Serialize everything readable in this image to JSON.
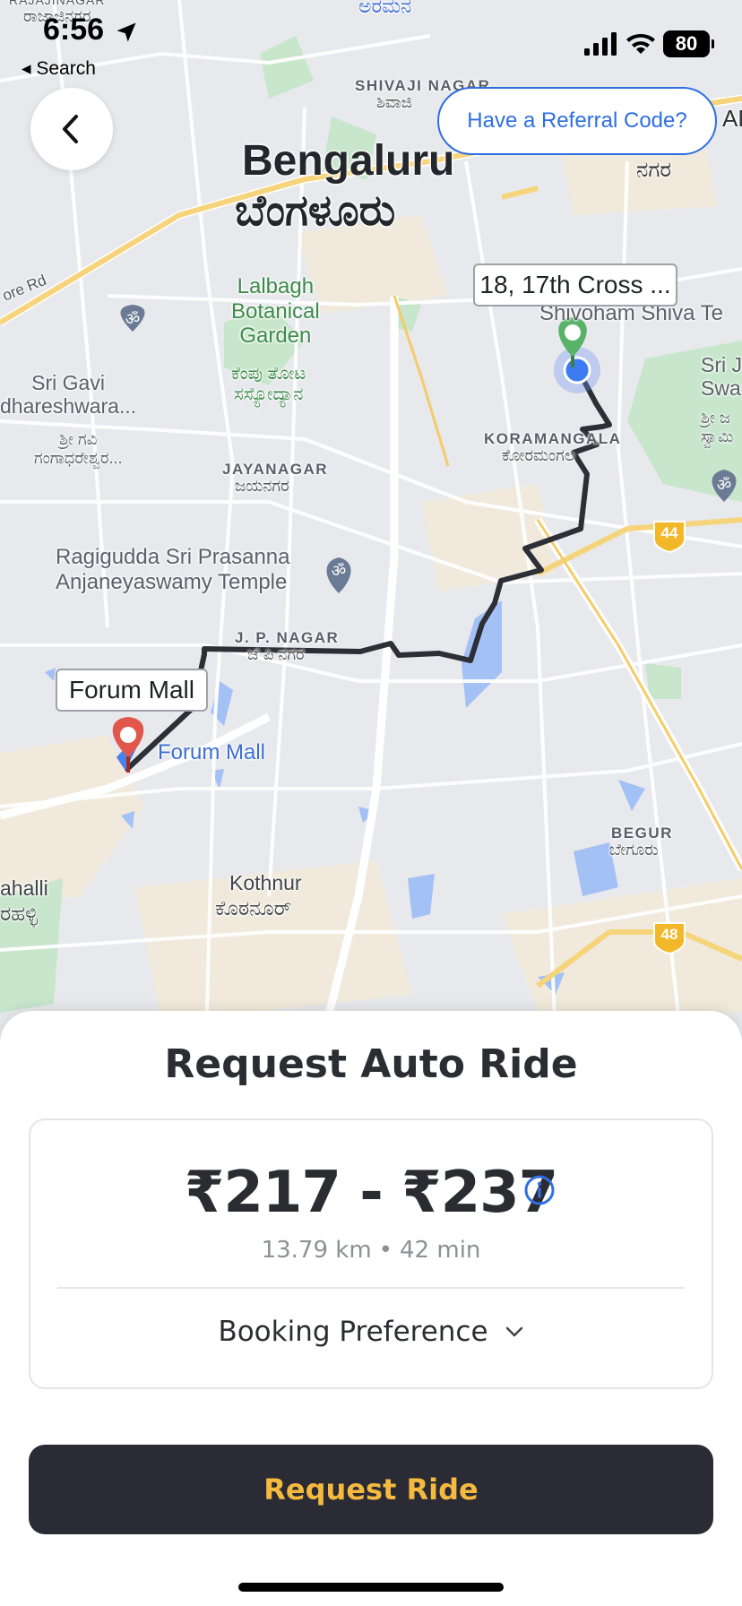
{
  "status_bar": {
    "time": "6:56",
    "back_app_label": "◂ Search",
    "battery": "80"
  },
  "map": {
    "referral_button": "Have a Referral Code?",
    "pickup_callout": "18, 17th Cross ...",
    "drop_callout": "Forum Mall",
    "drop_pin_label": "Forum Mall",
    "labels": {
      "bengaluru": "Bengaluru",
      "bengaluru_kn": "ಬೆಂಗಳೂರು",
      "shivaji_nagar": "SHIVAJI NAGAR",
      "shivaji_nagar_kn": "ಶಿವಾಜಿ",
      "aramane": "ಅರಮನ",
      "rajajinagar_kn": "ರಾಜಾಜಿನಗರ",
      "rajajinagar": "RAJAJINAGAR",
      "nagara_kn": "ನಗರ",
      "ar": "AR",
      "lalbagh": "Lalbagh\nBotanical\nGarden",
      "lalbagh_kn": "ಕೆಂಪು ತೋಟ\nಸಸ್ಯೋದ್ಯಾನ",
      "shivoham": "Shivoham Shiva Te",
      "sri_gavi": "Sri Gavi\ndhareshwara...",
      "sri_gavi_kn": "ಶ್ರೀ ಗವಿ\nಗಂಗಾಧರೇಶ್ವರ...",
      "sri_swa": "Sri J\nSwa",
      "sri_swa_kn": "ಶ್ರೀ ಜ\nಸ್ವಾಮಿ",
      "koramangala": "KORAMANGALA",
      "koramangala_kn": "ಕೋರಮಂಗಲ",
      "jayanagar": "JAYANAGAR",
      "jayanagar_kn": "ಜಯನಗರ",
      "ragigudda": "Ragigudda Sri Prasanna\nAnjaneyaswamy Temple",
      "jp_nagar": "J. P. NAGAR",
      "jp_nagar_kn": "ಜೆ ಪಿ ನಗರ",
      "begur": "BEGUR",
      "begur_kn": "ಬೇಗೂರು",
      "kothnur": "Kothnur",
      "kothnur_kn": "ಕೊಠನೂರ್",
      "ahalli": "ahalli",
      "ahalli_kn": "ರಹಳ್ಳಿ",
      "ore_rd": "ore Rd",
      "hwy_44": "44",
      "hwy_48": "48"
    }
  },
  "sheet": {
    "title": "Request Auto Ride",
    "fare_range": "₹217 - ₹237",
    "distance": "13.79 km",
    "separator": "•",
    "duration": "42 min",
    "booking_preference": "Booking Preference",
    "request_button": "Request Ride"
  },
  "colors": {
    "accent_blue": "#2f6fe0",
    "button_dark": "#2a2b34",
    "button_text": "#f4b93f",
    "route": "#2c2f36",
    "pickup_pin": "#58b368",
    "drop_pin": "#e2574c"
  }
}
